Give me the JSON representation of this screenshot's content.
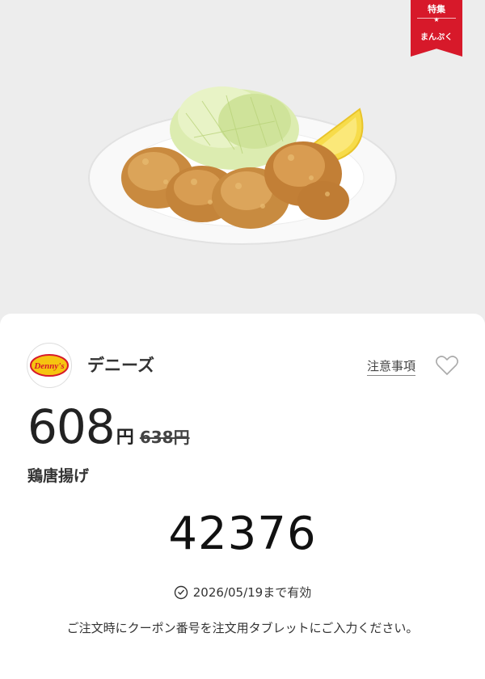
{
  "badge": {
    "top": "特集",
    "star": "★",
    "bottom": "まんぷく"
  },
  "store": {
    "name": "デニーズ",
    "logo_text": "Denny's",
    "notes_link": "注意事項"
  },
  "icons": {
    "favorite": "heart-outline-icon",
    "clock": "clock-icon"
  },
  "price": {
    "current": "608",
    "unit": "円",
    "original": "638円"
  },
  "item": {
    "name": "鶏唐揚げ"
  },
  "coupon": {
    "code": "42376",
    "validity": "2026/05/19まで有効",
    "instruction": "ご注文時にクーポン番号を注文用タブレットにご入力ください。"
  },
  "colors": {
    "ribbon": "#d7192a",
    "logo_yellow": "#f6c410",
    "logo_red": "#d7192a"
  }
}
